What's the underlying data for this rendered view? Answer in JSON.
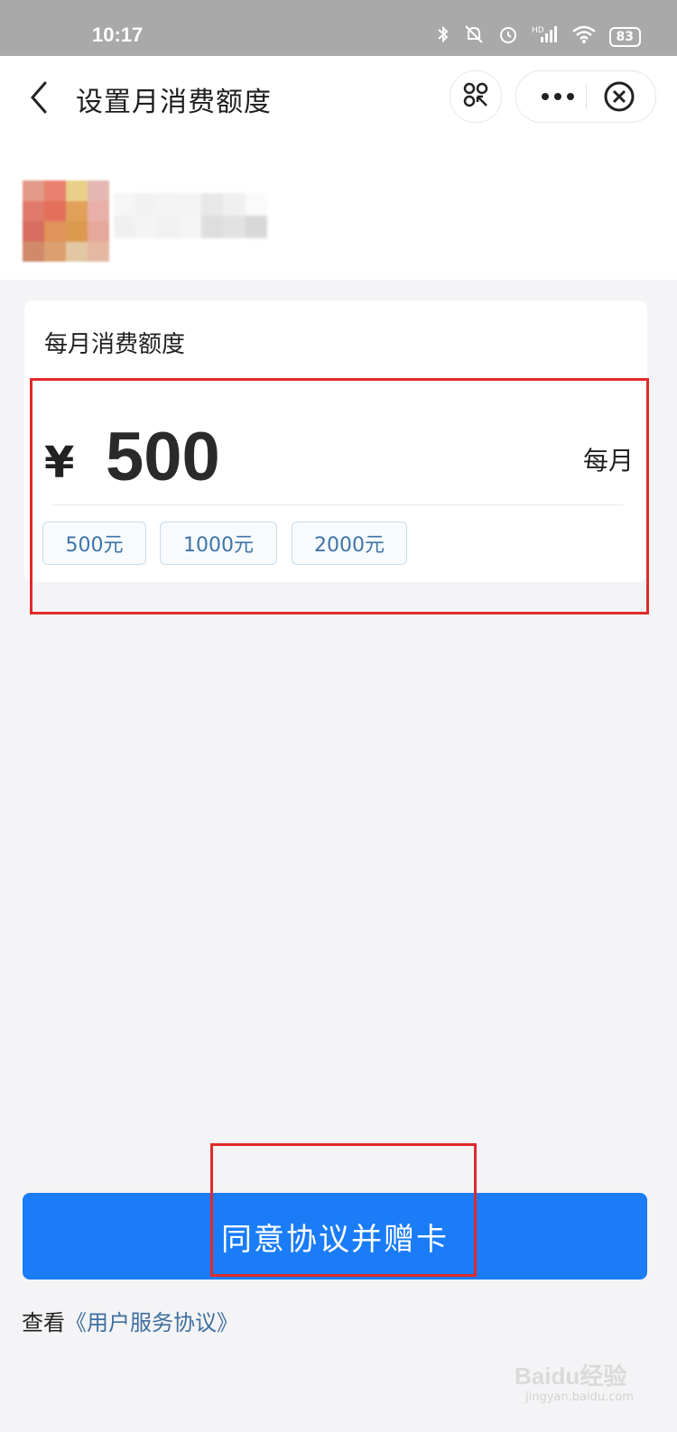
{
  "status_bar": {
    "time": "10:17",
    "battery": "83",
    "network": "HD",
    "icons": [
      "bluetooth-icon",
      "mute-icon",
      "alarm-icon",
      "signal-icon",
      "wifi-icon",
      "battery-icon"
    ]
  },
  "header": {
    "title": "设置月消费额度",
    "icons": [
      "back-icon",
      "scan-icon",
      "more-icon",
      "close-icon"
    ]
  },
  "card": {
    "title": "每月消费额度",
    "currency": "¥",
    "amount": "500",
    "period": "每月",
    "options": [
      "500元",
      "1000元",
      "2000元"
    ]
  },
  "submit": {
    "label": "同意协议并赠卡"
  },
  "agreement": {
    "prefix": "查看",
    "link": "《用户服务协议》"
  },
  "watermark": {
    "text": "Baidu经验",
    "sub": "jingyan.baidu.com"
  },
  "colors": {
    "primary": "#1a7cf7",
    "highlight": "#e12a2a",
    "chip_text": "#3f74a6"
  }
}
